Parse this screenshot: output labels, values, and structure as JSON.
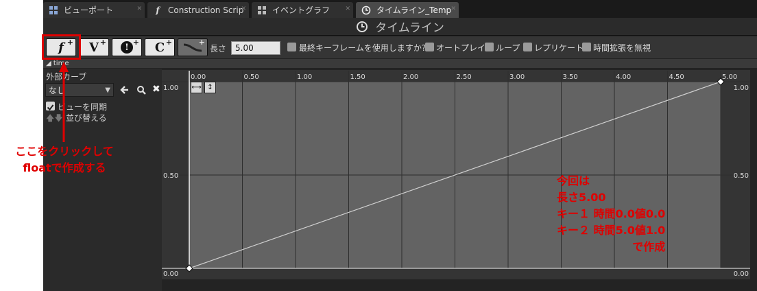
{
  "tabs": [
    {
      "label": "ビューポート",
      "icon": "grid-icon"
    },
    {
      "label": "Construction Scrip",
      "icon": "function-icon"
    },
    {
      "label": "イベントグラフ",
      "icon": "grid-icon"
    },
    {
      "label": "タイムライン_Temp",
      "icon": "clock-icon"
    }
  ],
  "title": "タイムライン",
  "toolbar": {
    "buttons": [
      "float-track",
      "vector-track",
      "event-track",
      "color-track",
      "external-curve"
    ],
    "btn_f": "f",
    "btn_v": "V",
    "btn_e": "!",
    "btn_c": "C",
    "plus": "+",
    "length_label": "長さ",
    "length_value": "5.00",
    "options": [
      {
        "label": "最終キーフレームを使用しますか?",
        "checked": false
      },
      {
        "label": "オートプレイ",
        "checked": false
      },
      {
        "label": "ループ",
        "checked": false
      },
      {
        "label": "レプリケート",
        "checked": false
      },
      {
        "label": "時間拡張を無視",
        "checked": false
      }
    ]
  },
  "track": {
    "name": "time",
    "external_curve_label": "外部カーブ",
    "curve_value": "なし",
    "sync_view_label": "ビューを同期",
    "sync_view_checked": true,
    "sort_label": "並び替える"
  },
  "chart_data": {
    "type": "line",
    "x_ticks": [
      "0.00",
      "0.50",
      "1.00",
      "1.50",
      "2.00",
      "2.50",
      "3.00",
      "3.50",
      "4.00",
      "4.50",
      "5.00"
    ],
    "y_ticks": [
      "0.00",
      "0.50",
      "1.00"
    ],
    "xlim": [
      0,
      5
    ],
    "ylim": [
      0,
      1
    ],
    "keys": [
      {
        "x": 0.0,
        "y": 0.0
      },
      {
        "x": 5.0,
        "y": 1.0
      }
    ],
    "grid": true,
    "fit_horizontal_icon": "fit-horizontal-icon",
    "fit_vertical_icon": "fit-vertical-icon"
  },
  "annotations": {
    "click_note_line1": "ここをクリックして",
    "click_note_line2": "floatで作成する",
    "info_lines": [
      "今回は",
      "長さ5.00",
      "キー１ 時間0.0値0.0",
      "キー２ 時間5.0値1.0",
      "で作成"
    ]
  },
  "colors": {
    "annotation": "#e00000",
    "highlight_box": "#e00000",
    "plot_bg": "#636363",
    "curve": "#d0d0d0"
  }
}
